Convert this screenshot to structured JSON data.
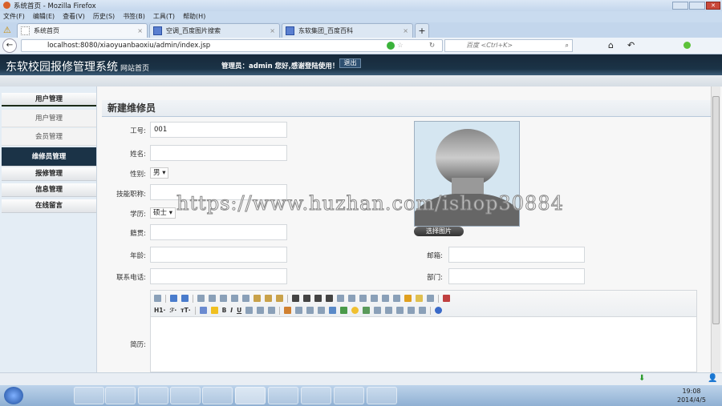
{
  "window": {
    "title": "系统首页 - Mozilla Firefox"
  },
  "menu": [
    "文件(F)",
    "编辑(E)",
    "查看(V)",
    "历史(S)",
    "书签(B)",
    "工具(T)",
    "帮助(H)"
  ],
  "tabs": [
    {
      "label": "系统首页"
    },
    {
      "label": "空调_百度图片搜索"
    },
    {
      "label": "东软集团_百度百科"
    }
  ],
  "nav": {
    "url": "localhost:8080/xiaoyuanbaoxiu/admin/index.jsp",
    "search_placeholder": "百度 <Ctrl+K>"
  },
  "header": {
    "title": "东软校园报修管理系统",
    "home_link": "网站首页",
    "welcome": "管理员：admin 您好,感谢登陆使用！",
    "logout": "退出"
  },
  "sidebar": {
    "groups": [
      {
        "label": "用户管理"
      },
      {
        "label": "报修管理"
      },
      {
        "label": "信息管理"
      },
      {
        "label": "在线留言"
      }
    ],
    "subitems": [
      {
        "label": "用户管理"
      },
      {
        "label": "会员管理"
      },
      {
        "label": "维修员管理"
      }
    ]
  },
  "form": {
    "title": "新建维修员",
    "fields": {
      "id": {
        "label": "工号:",
        "value": "001"
      },
      "name": {
        "label": "姓名:",
        "value": ""
      },
      "gender": {
        "label": "性别:",
        "value": "男"
      },
      "title": {
        "label": "技能职称:",
        "value": ""
      },
      "edu": {
        "label": "学历:",
        "value": "硕士"
      },
      "origin": {
        "label": "籍贯:",
        "value": ""
      },
      "age": {
        "label": "年龄:",
        "value": ""
      },
      "phone": {
        "label": "联系电话:",
        "value": ""
      },
      "email": {
        "label": "邮箱:",
        "value": ""
      },
      "dept": {
        "label": "部门:",
        "value": ""
      },
      "resume": {
        "label": "简历:"
      }
    },
    "pick_image": "选择图片",
    "editor_tb": {
      "h1": "H1·",
      "font": "ℱ·",
      "size": "тT·",
      "bold": "B",
      "italic": "I",
      "underline": "U"
    }
  },
  "watermark": "https://www.huzhan.com/ishop30884",
  "taskbar": {
    "time": "19:08",
    "date": "2014/4/5"
  }
}
